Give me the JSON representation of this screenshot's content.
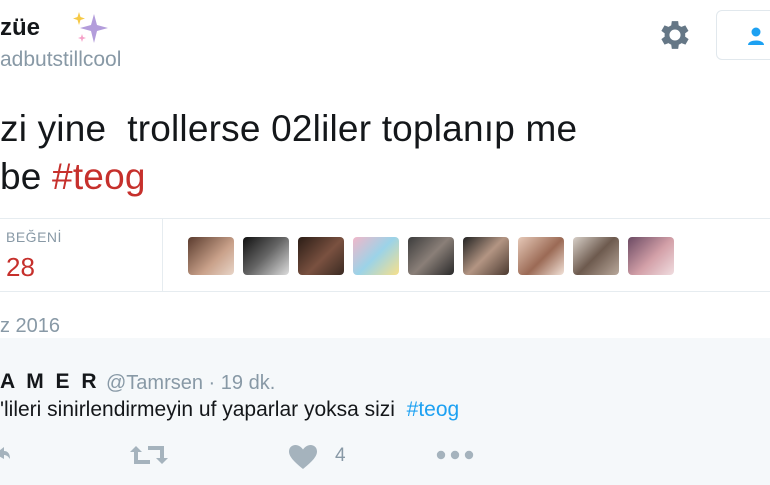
{
  "profile": {
    "name_fragment": "züe",
    "handle_fragment": "adbutstillcool"
  },
  "tweet": {
    "line1": "zi yine  trollerse 02liler toplanıp me",
    "line2_prefix": "be ",
    "hashtag": "#teog"
  },
  "stats": {
    "likes_label": "BEĞENİ",
    "likes_count": "28"
  },
  "date": "z 2016",
  "reply": {
    "name": "A M E R",
    "handle": "@Tamrsen",
    "separator": " · ",
    "time": "19 dk.",
    "text_prefix": "'lileri sinirlendirmeyin uf yaparlar yoksa sizi  ",
    "hashtag": "#teog",
    "like_count": "4"
  },
  "icons": {
    "sparkle": "sparkles-icon",
    "settings": "gear-icon",
    "follow": "follow-user-icon",
    "reply": "reply-icon",
    "retweet": "retweet-icon",
    "like": "heart-icon",
    "more": "more-dots-icon"
  },
  "colors": {
    "brand_blue": "#1da1f2",
    "hashtag_red": "#c6302c",
    "muted": "#8899a6",
    "reply_bg": "#f5f8fa"
  }
}
